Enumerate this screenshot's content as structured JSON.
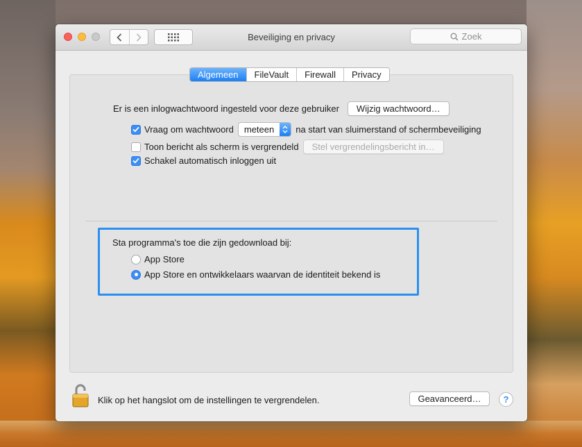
{
  "window": {
    "title": "Beveiliging en privacy"
  },
  "search": {
    "placeholder": "Zoek"
  },
  "tabs": [
    {
      "label": "Algemeen",
      "active": true
    },
    {
      "label": "FileVault",
      "active": false
    },
    {
      "label": "Firewall",
      "active": false
    },
    {
      "label": "Privacy",
      "active": false
    }
  ],
  "general": {
    "password_text": "Er is een inlogwachtwoord ingesteld voor deze gebruiker",
    "change_password_button": "Wijzig wachtwoord…",
    "require_password": {
      "checked": true,
      "label": "Vraag om wachtwoord",
      "select_value": "meteen",
      "suffix": "na start van sluimerstand of schermbeveiliging"
    },
    "show_message": {
      "checked": false,
      "label": "Toon bericht als scherm is vergrendeld",
      "button": "Stel vergrendelingsbericht in…"
    },
    "disable_autologin": {
      "checked": true,
      "label": "Schakel automatisch inloggen uit"
    }
  },
  "downloads": {
    "heading": "Sta programma's toe die zijn gedownload bij:",
    "options": [
      {
        "label": "App Store",
        "selected": false
      },
      {
        "label": "App Store en ontwikkelaars waarvan de identiteit bekend is",
        "selected": true
      }
    ]
  },
  "footer": {
    "lock_text": "Klik op het hangslot om de instellingen te vergrendelen.",
    "advanced_button": "Geavanceerd…",
    "help_label": "?"
  },
  "colors": {
    "accent": "#1d7ff5",
    "highlight_border": "#2a8ff0"
  }
}
